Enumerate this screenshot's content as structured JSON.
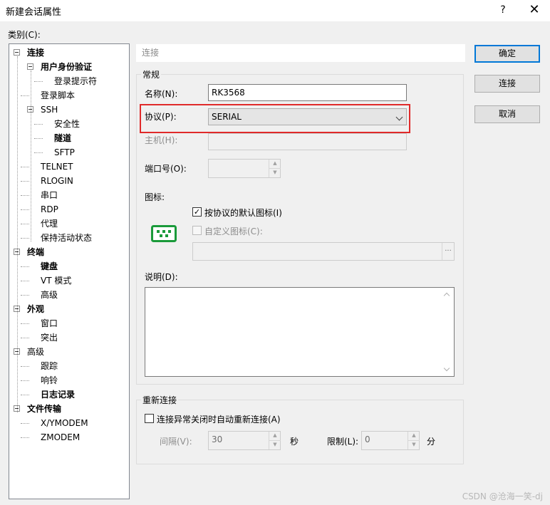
{
  "window": {
    "title": "新建会话属性",
    "help_label": "?",
    "close_label": "✕"
  },
  "category_label": "类别(C):",
  "tree": [
    {
      "label": "连接",
      "bold": true,
      "toggle": true
    },
    {
      "label": "用户身份验证",
      "bold": true,
      "toggle": true
    },
    {
      "label": "登录提示符",
      "bold": false,
      "toggle": false
    },
    {
      "label": "登录脚本",
      "bold": false,
      "toggle": false
    },
    {
      "label": "SSH",
      "bold": false,
      "toggle": true
    },
    {
      "label": "安全性",
      "bold": false,
      "toggle": false
    },
    {
      "label": "隧道",
      "bold": true,
      "toggle": false
    },
    {
      "label": "SFTP",
      "bold": false,
      "toggle": false
    },
    {
      "label": "TELNET",
      "bold": false,
      "toggle": false
    },
    {
      "label": "RLOGIN",
      "bold": false,
      "toggle": false
    },
    {
      "label": "串口",
      "bold": false,
      "toggle": false
    },
    {
      "label": "RDP",
      "bold": false,
      "toggle": false
    },
    {
      "label": "代理",
      "bold": false,
      "toggle": false
    },
    {
      "label": "保持活动状态",
      "bold": false,
      "toggle": false
    },
    {
      "label": "终端",
      "bold": true,
      "toggle": true
    },
    {
      "label": "键盘",
      "bold": true,
      "toggle": false
    },
    {
      "label": "VT 模式",
      "bold": false,
      "toggle": false
    },
    {
      "label": "高级",
      "bold": false,
      "toggle": false
    },
    {
      "label": "外观",
      "bold": true,
      "toggle": true
    },
    {
      "label": "窗口",
      "bold": false,
      "toggle": false
    },
    {
      "label": "突出",
      "bold": false,
      "toggle": false
    },
    {
      "label": "高级",
      "bold": false,
      "toggle": true
    },
    {
      "label": "跟踪",
      "bold": false,
      "toggle": false
    },
    {
      "label": "响铃",
      "bold": false,
      "toggle": false
    },
    {
      "label": "日志记录",
      "bold": true,
      "toggle": false
    },
    {
      "label": "文件传输",
      "bold": true,
      "toggle": true
    },
    {
      "label": "X/YMODEM",
      "bold": false,
      "toggle": false
    },
    {
      "label": "ZMODEM",
      "bold": false,
      "toggle": false
    }
  ],
  "header": {
    "title": "连接"
  },
  "general": {
    "group_title": "常规",
    "name_label": "名称(N):",
    "name_value": "RK3568",
    "protocol_label": "协议(P):",
    "protocol_value": "SERIAL",
    "host_label": "主机(H):",
    "host_value": "",
    "port_label": "端口号(O):",
    "port_value": "",
    "icon_label": "图标:",
    "default_icon_label": "按协议的默认图标(I)",
    "default_icon_checked": "✓",
    "custom_icon_label": "自定义图标(C):",
    "custom_icon_path": "",
    "browse_label": "...",
    "desc_label": "说明(D):",
    "desc_value": ""
  },
  "reconnect": {
    "group_title": "重新连接",
    "auto_label": "连接异常关闭时自动重新连接(A)",
    "interval_label": "间隔(V):",
    "interval_value": "30",
    "interval_unit": "秒",
    "limit_label": "限制(L):",
    "limit_value": "0",
    "limit_unit": "分"
  },
  "buttons": {
    "ok": "确定",
    "connect": "连接",
    "cancel": "取消"
  },
  "watermark": "CSDN @沧海一笑-dj",
  "colors": {
    "highlight_border": "#e02a2a",
    "default_button_border": "#0078d7",
    "serial_icon": "#1a9a3a"
  }
}
